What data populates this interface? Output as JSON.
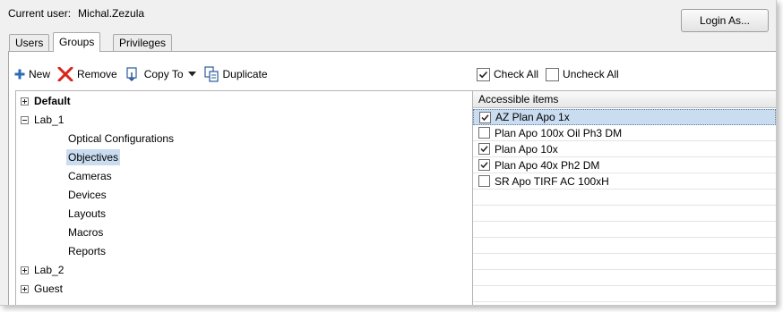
{
  "header": {
    "current_user_label": "Current user:",
    "current_user_value": "Michal.Zezula",
    "login_button": "Login As..."
  },
  "tabs": [
    {
      "label": "Users",
      "active": false
    },
    {
      "label": "Groups",
      "active": true
    },
    {
      "label": "Privileges",
      "active": false
    }
  ],
  "toolbar": {
    "new": "New",
    "remove": "Remove",
    "copy_to": "Copy To",
    "duplicate": "Duplicate"
  },
  "checks": {
    "check_all": "Check All",
    "uncheck_all": "Uncheck All"
  },
  "tree": [
    {
      "label": "Default",
      "bold": true,
      "expander": "plus",
      "level": 0
    },
    {
      "label": "Lab_1",
      "bold": false,
      "expander": "minus",
      "level": 0
    },
    {
      "label": "Optical Configurations",
      "level": 1
    },
    {
      "label": "Objectives",
      "level": 1,
      "selected": true
    },
    {
      "label": "Cameras",
      "level": 1
    },
    {
      "label": "Devices",
      "level": 1
    },
    {
      "label": "Layouts",
      "level": 1
    },
    {
      "label": "Macros",
      "level": 1
    },
    {
      "label": "Reports",
      "level": 1
    },
    {
      "label": "Lab_2",
      "bold": false,
      "expander": "plus",
      "level": 0
    },
    {
      "label": "Guest",
      "bold": false,
      "expander": "plus",
      "level": 0
    }
  ],
  "list": {
    "header": "Accessible items",
    "items": [
      {
        "label": "AZ Plan Apo 1x",
        "checked": true,
        "selected": true
      },
      {
        "label": "Plan Apo 100x Oil Ph3 DM",
        "checked": false
      },
      {
        "label": "Plan Apo 10x",
        "checked": true
      },
      {
        "label": "Plan Apo 40x Ph2 DM",
        "checked": true
      },
      {
        "label": "SR Apo TIRF AC 100xH",
        "checked": false
      }
    ]
  },
  "colors": {
    "new_icon": "#2c6bb8",
    "remove_icon": "#d9261c",
    "selection": "#c9dcf0"
  }
}
